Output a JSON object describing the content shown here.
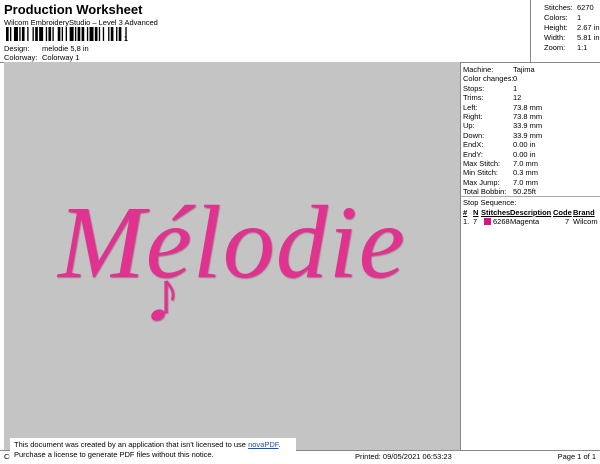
{
  "header": {
    "title": "Production Worksheet",
    "subtitle": "Wilcom EmbroideryStudio – Level 3 Advanced",
    "barcode_number": "1",
    "design_label": "Design:",
    "design_value": "melodie 5,8 in",
    "colorway_label": "Colorway:",
    "colorway_value": "Colorway 1"
  },
  "stats": [
    {
      "label": "Stitches:",
      "value": "6270"
    },
    {
      "label": "Colors:",
      "value": "1"
    },
    {
      "label": "Height:",
      "value": "2.67 in"
    },
    {
      "label": "Width:",
      "value": "5.81 in"
    },
    {
      "label": "Zoom:",
      "value": "1:1"
    }
  ],
  "design": {
    "text": "Mélodie",
    "thread_color": "#e0338f",
    "canvas_color": "#c4c4c4"
  },
  "machine": [
    {
      "label": "Machine:",
      "value": "Tajima"
    },
    {
      "label": "Color changes:",
      "value": "0"
    },
    {
      "label": "Stops:",
      "value": "1"
    },
    {
      "label": "Trims:",
      "value": "12"
    },
    {
      "label": "Left:",
      "value": "73.8 mm"
    },
    {
      "label": "Right:",
      "value": "73.8 mm"
    },
    {
      "label": "Up:",
      "value": "33.9 mm"
    },
    {
      "label": "Down:",
      "value": "33.9 mm"
    },
    {
      "label": "EndX:",
      "value": "0.00 in"
    },
    {
      "label": "EndY:",
      "value": "0.00 in"
    },
    {
      "label": "Max Stitch:",
      "value": "7.0 mm"
    },
    {
      "label": "Min Stitch:",
      "value": "0.3 mm"
    },
    {
      "label": "Max Jump:",
      "value": "7.0 mm"
    },
    {
      "label": "Total Bobbin:",
      "value": "50.25ft"
    }
  ],
  "stop_sequence": {
    "title": "Stop Sequence:",
    "headers": [
      "#",
      "N",
      "Stitches",
      "Description",
      "Code",
      "Brand"
    ],
    "rows": [
      {
        "num": "1.",
        "n": "7",
        "stitches": "6268",
        "description": "Magenta",
        "code": "7",
        "brand": "Wilcom",
        "color": "#d6147e"
      }
    ]
  },
  "footer": {
    "left": "Cr",
    "printed": "Printed: 09/05/2021 06:53:23",
    "page": "Page 1 of 1"
  },
  "notice": {
    "line1_pre": "This document was created by an application that isn't licensed to use ",
    "link": "novaPDF",
    "line1_post": ".",
    "line2": "Purchase a license to generate PDF files without this notice."
  }
}
